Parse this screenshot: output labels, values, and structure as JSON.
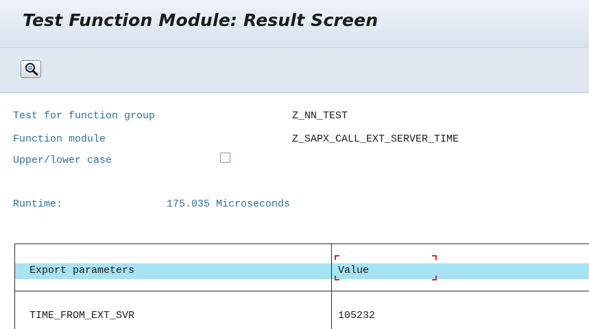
{
  "window": {
    "title": "Test Function Module: Result Screen"
  },
  "toolbar": {
    "buttons": [
      {
        "icon": "magnifier-icon"
      }
    ]
  },
  "info": {
    "group_label": "Test for function group",
    "group_value": "Z_NN_TEST",
    "module_label": "Function module",
    "module_value": "Z_SAPX_CALL_EXT_SERVER_TIME",
    "case_label": "Upper/lower case",
    "case_checked": false,
    "runtime_label": "Runtime:",
    "runtime_value": "175.035 Microseconds"
  },
  "table": {
    "headers": [
      "Export parameters",
      "Value"
    ],
    "rows": [
      [
        "TIME_FROM_EXT_SVR",
        "105232"
      ]
    ]
  },
  "colors": {
    "label_text": "#2f6f98",
    "header_bg": "#a6e3f3",
    "focus_bracket": "#d9262b"
  }
}
